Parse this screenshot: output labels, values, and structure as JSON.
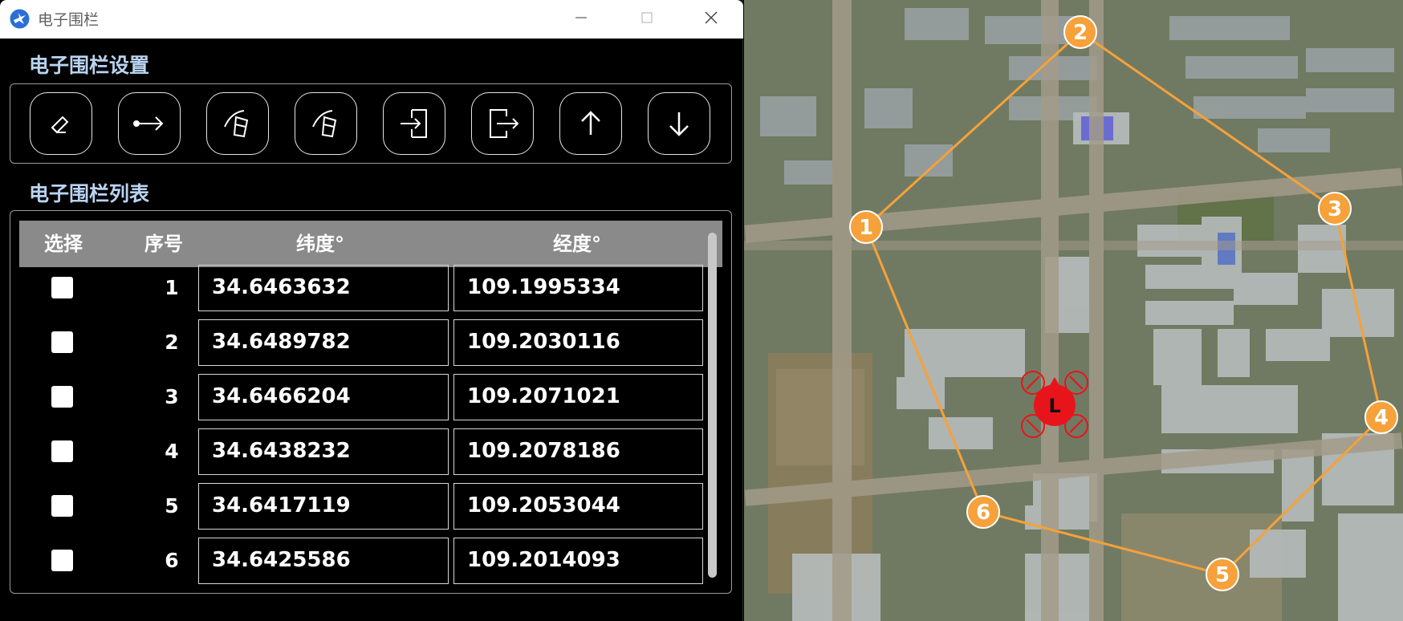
{
  "window": {
    "title": "电子围栏",
    "minimize_glyph": "─",
    "maximize_glyph": "☐",
    "close_glyph": "✕"
  },
  "fence_settings": {
    "title": "电子围栏设置",
    "buttons": [
      {
        "name": "draw-fence",
        "icon": "pencil-icon"
      },
      {
        "name": "add-point",
        "icon": "dot-arrow-icon"
      },
      {
        "name": "clear-fence-1",
        "icon": "eraser-icon"
      },
      {
        "name": "clear-fence-2",
        "icon": "eraser-icon"
      },
      {
        "name": "import-fence",
        "icon": "import-icon"
      },
      {
        "name": "export-fence",
        "icon": "export-icon"
      },
      {
        "name": "upload-fence",
        "icon": "arrow-up-icon"
      },
      {
        "name": "download-fence",
        "icon": "arrow-down-icon"
      }
    ]
  },
  "fence_list": {
    "title": "电子围栏列表",
    "columns": [
      "选择",
      "序号",
      "纬度°",
      "经度°"
    ],
    "rows": [
      {
        "seq": "1",
        "lat": "34.6463632",
        "lon": "109.1995334",
        "checked": false
      },
      {
        "seq": "2",
        "lat": "34.6489782",
        "lon": "109.2030116",
        "checked": false
      },
      {
        "seq": "3",
        "lat": "34.6466204",
        "lon": "109.2071021",
        "checked": false
      },
      {
        "seq": "4",
        "lat": "34.6438232",
        "lon": "109.2078186",
        "checked": false
      },
      {
        "seq": "5",
        "lat": "34.6417119",
        "lon": "109.2053044",
        "checked": false
      },
      {
        "seq": "6",
        "lat": "34.6425586",
        "lon": "109.2014093",
        "checked": false
      }
    ]
  },
  "map": {
    "fence_markers": [
      "1",
      "2",
      "3",
      "4",
      "5",
      "6"
    ],
    "vehicle_label": "L",
    "colors": {
      "fence": "#f6a13a",
      "vehicle": "#e8141b",
      "marker_text": "#ffffff"
    }
  }
}
